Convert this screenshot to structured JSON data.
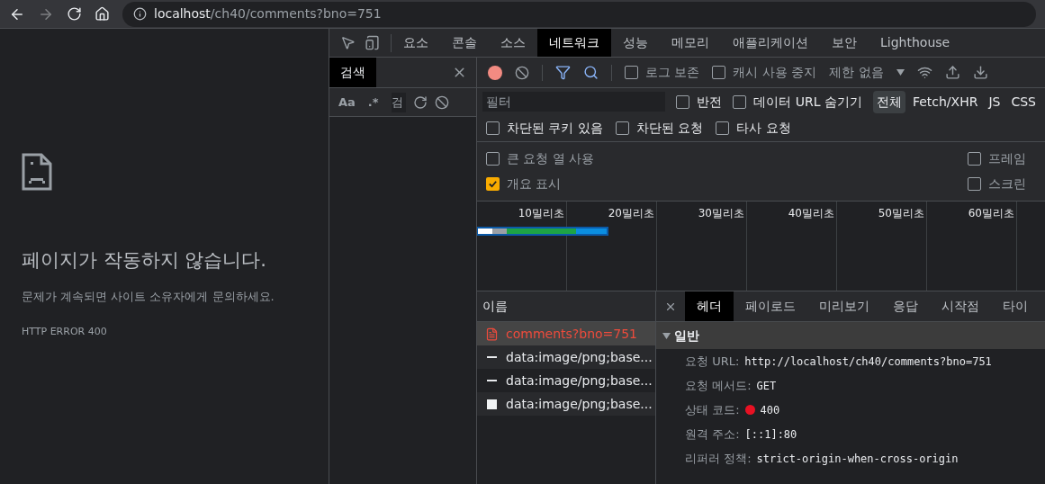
{
  "browser": {
    "forward_disabled": true,
    "url_host": "localhost",
    "url_path": "/ch40/comments?bno=751"
  },
  "error_page": {
    "title": "페이지가 작동하지 않습니다.",
    "message": "문제가 계속되면 사이트 소유자에게 문의하세요.",
    "code": "HTTP ERROR 400"
  },
  "devtools": {
    "tabs": [
      {
        "label": "요소",
        "selected": false
      },
      {
        "label": "콘솔",
        "selected": false
      },
      {
        "label": "소스",
        "selected": false
      },
      {
        "label": "네트워크",
        "selected": true
      },
      {
        "label": "성능",
        "selected": false
      },
      {
        "label": "메모리",
        "selected": false
      },
      {
        "label": "애플리케이션",
        "selected": false
      },
      {
        "label": "보안",
        "selected": false
      },
      {
        "label": "Lighthouse",
        "selected": false
      }
    ],
    "search_panel": {
      "title": "검색",
      "match_case": "Aa",
      "regex": ".*",
      "placeholder": "검"
    },
    "network": {
      "recording": true,
      "preserve_log": {
        "label": "로그 보존",
        "checked": false
      },
      "disable_cache": {
        "label": "캐시 사용 중지",
        "checked": false
      },
      "throttling": "제한 없음",
      "filter": {
        "placeholder": "필터",
        "invert": {
          "label": "반전",
          "checked": false
        },
        "hide_data_urls": {
          "label": "데이터 URL 숨기기",
          "checked": false
        },
        "types": [
          {
            "label": "전체",
            "selected": true
          },
          {
            "label": "Fetch/XHR",
            "selected": false
          },
          {
            "label": "JS",
            "selected": false
          },
          {
            "label": "CSS",
            "selected": false
          }
        ]
      },
      "filter_checks": [
        {
          "label": "차단된 쿠키 있음",
          "checked": false
        },
        {
          "label": "차단된 요청",
          "checked": false
        },
        {
          "label": "타사 요청",
          "checked": false
        }
      ],
      "settings_left": [
        {
          "label": "큰 요청 열 사용",
          "checked": false
        },
        {
          "label": "개요 표시",
          "checked": true
        }
      ],
      "settings_right": [
        {
          "label": "프레임",
          "checked": false
        },
        {
          "label": "스크린",
          "checked": false
        }
      ],
      "timeline": {
        "ticks": [
          "10밀리초",
          "20밀리초",
          "30밀리초",
          "40밀리초",
          "50밀리초",
          "60밀리초"
        ]
      },
      "requests": {
        "column": "이름",
        "rows": [
          {
            "name": "comments?bno=751",
            "kind": "document",
            "selected": true,
            "error": true
          },
          {
            "name": "data:image/png;base...",
            "kind": "dash",
            "selected": false,
            "error": false
          },
          {
            "name": "data:image/png;base...",
            "kind": "dash",
            "selected": false,
            "error": false
          },
          {
            "name": "data:image/png;base...",
            "kind": "image",
            "selected": false,
            "error": false
          }
        ]
      },
      "details": {
        "tabs": [
          {
            "label": "헤더",
            "selected": true
          },
          {
            "label": "페이로드",
            "selected": false
          },
          {
            "label": "미리보기",
            "selected": false
          },
          {
            "label": "응답",
            "selected": false
          },
          {
            "label": "시작점",
            "selected": false
          },
          {
            "label": "타이",
            "selected": false
          }
        ],
        "section": {
          "title": "일반",
          "expanded": true,
          "rows": [
            {
              "label": "요청 URL:",
              "value": "http://localhost/ch40/comments?bno=751",
              "kind": "text"
            },
            {
              "label": "요청 메서드:",
              "value": "GET",
              "kind": "text"
            },
            {
              "label": "상태 코드:",
              "value": "400",
              "kind": "status",
              "color": "#e81123"
            },
            {
              "label": "원격 주소:",
              "value": "[::1]:80",
              "kind": "text"
            },
            {
              "label": "리퍼러 정책:",
              "value": "strict-origin-when-cross-origin",
              "kind": "text"
            }
          ]
        }
      }
    }
  }
}
